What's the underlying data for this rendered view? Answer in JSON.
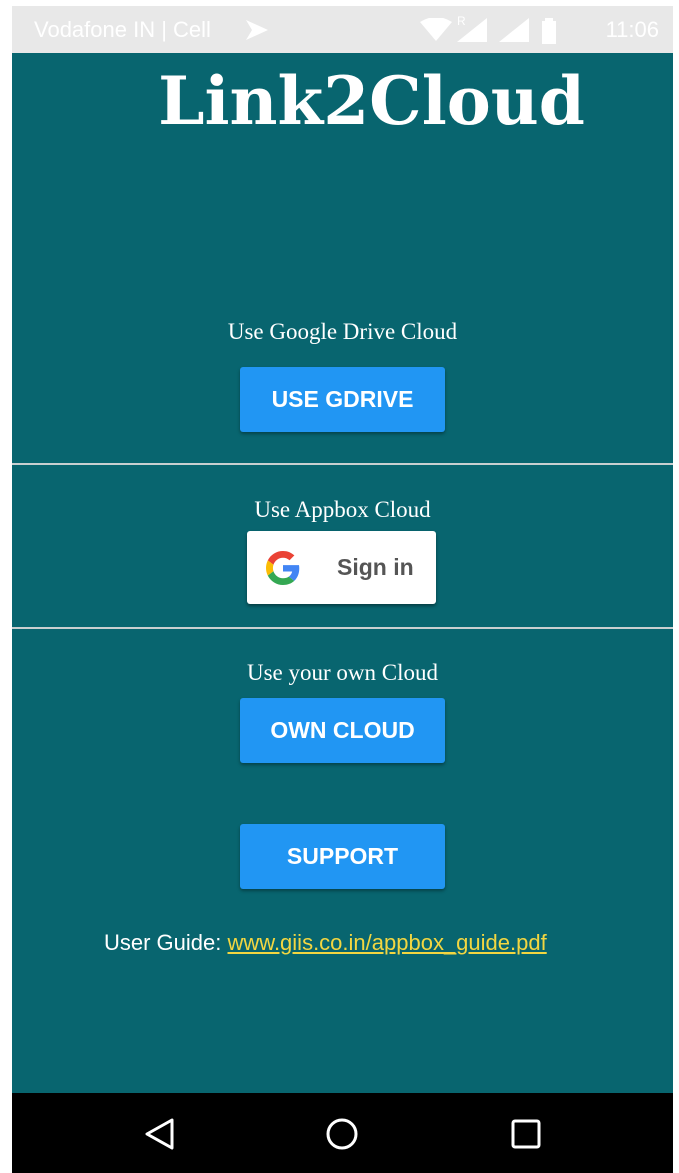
{
  "status_bar": {
    "carrier": "Vodafone IN | Cell",
    "roaming_mark": "R",
    "time": "11:06"
  },
  "app": {
    "title": "Link2Cloud",
    "background_color": "#08656f",
    "accent_color": "#2196f3",
    "gdrive": {
      "label": "Use Google Drive Cloud",
      "button": "USE GDRIVE"
    },
    "appbox": {
      "label": "Use Appbox Cloud",
      "signin_button": "Sign in",
      "signin_icon": "google-g-icon"
    },
    "own": {
      "label": "Use your own Cloud",
      "button": "OWN CLOUD"
    },
    "support": {
      "button": "SUPPORT"
    },
    "guide": {
      "prefix": "User Guide: ",
      "link": "www.giis.co.in/appbox_guide.pdf"
    }
  },
  "nav_bar": {
    "back_icon": "back-triangle-icon",
    "home_icon": "home-circle-icon",
    "recents_icon": "recents-square-icon"
  }
}
